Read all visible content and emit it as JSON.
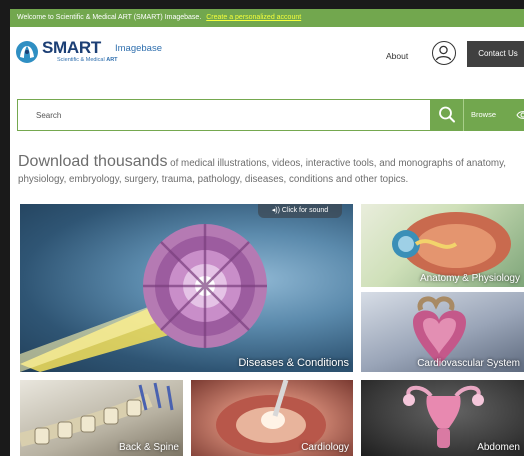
{
  "banner": {
    "text": "Welcome to Scientific & Medical ART (SMART) Imagebase.",
    "link": "Create a personalized account"
  },
  "logo": {
    "brand": "SMART",
    "product": "Imagebase",
    "tagline_prefix": "Scientific & Medical",
    "tagline_bold": "ART"
  },
  "nav": {
    "about": "About",
    "contact": "Contact Us",
    "account_icon": "user-circle-icon"
  },
  "search": {
    "placeholder": "Search",
    "browse": "Browse",
    "search_icon": "search-icon",
    "browse_icon": "eye-icon"
  },
  "headline": {
    "big": "Download thousands",
    "rest": " of medical illustrations, videos, interactive tools, and monographs of anatomy, physiology, embryology, surgery, trauma, pathology, diseases, conditions and other topics."
  },
  "tiles": {
    "featured": {
      "label": "Diseases & Conditions",
      "sound": "◂)) Click for sound"
    },
    "anatomy": "Anatomy & Physiology",
    "cardiovascular": "Cardiovascular System",
    "back": "Back & Spine",
    "cardiology": "Cardiology",
    "abdomen": "Abdomen"
  },
  "colors": {
    "brand_green": "#72a74e",
    "banner_link": "#f4ff3b",
    "logo_navy": "#1c3f75",
    "contact_bg": "#404040"
  }
}
